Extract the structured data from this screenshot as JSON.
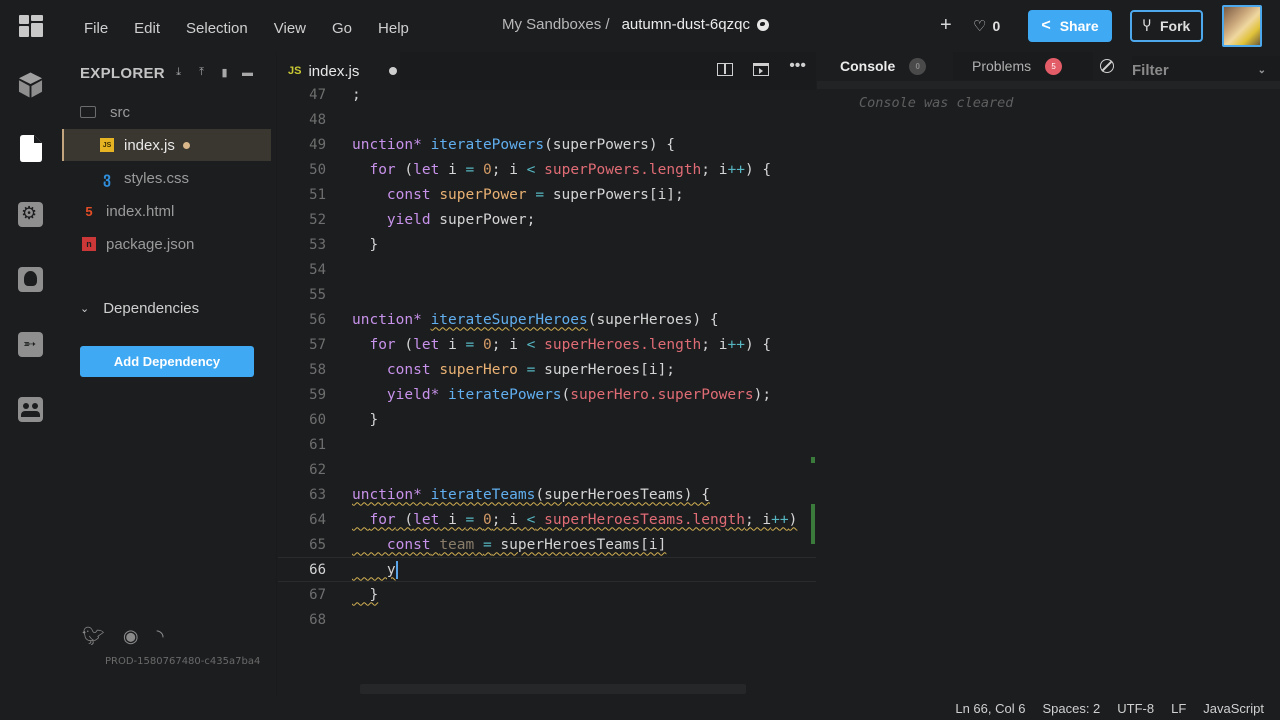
{
  "topbar": {
    "menu": [
      "File",
      "Edit",
      "Selection",
      "View",
      "Go",
      "Help"
    ],
    "breadcrumb_parent": "My Sandboxes /",
    "sandbox_title": "autumn-dust-6qzqc",
    "likes_count": "0",
    "share_label": "Share",
    "fork_label": "Fork",
    "accent_color": "#40a9f3"
  },
  "activity_bar": {
    "items": [
      "cube-icon",
      "file-icon",
      "gear-icon",
      "github-icon",
      "rocket-icon",
      "users-icon"
    ],
    "active": "file-icon"
  },
  "sidebar": {
    "header": "EXPLORER",
    "header_actions": [
      "download-icon",
      "upload-icon",
      "new-file-icon",
      "new-folder-icon"
    ],
    "files": [
      {
        "name": "src",
        "type": "folder"
      },
      {
        "name": "index.js",
        "type": "js",
        "active": true,
        "modified": true
      },
      {
        "name": "styles.css",
        "type": "css"
      },
      {
        "name": "index.html",
        "type": "html"
      },
      {
        "name": "package.json",
        "type": "json"
      }
    ],
    "dependencies_label": "Dependencies",
    "add_dependency_label": "Add Dependency",
    "build_id": "PROD-1580767480-c435a7ba4"
  },
  "editor": {
    "tab": {
      "label": "index.js",
      "icon": "JS",
      "modified": true
    },
    "lines": [
      {
        "n": "47",
        "text": ";"
      },
      {
        "n": "48",
        "text": ""
      },
      {
        "n": "49",
        "text": "unction* iteratePowers(superPowers) {"
      },
      {
        "n": "50",
        "text": "  for (let i = 0; i < superPowers.length; i++) {"
      },
      {
        "n": "51",
        "text": "    const superPower = superPowers[i];"
      },
      {
        "n": "52",
        "text": "    yield superPower;"
      },
      {
        "n": "53",
        "text": "  }"
      },
      {
        "n": "54",
        "text": ""
      },
      {
        "n": "55",
        "text": ""
      },
      {
        "n": "56",
        "text": "unction* iterateSuperHeroes(superHeroes) {"
      },
      {
        "n": "57",
        "text": "  for (let i = 0; i < superHeroes.length; i++) {"
      },
      {
        "n": "58",
        "text": "    const superHero = superHeroes[i];"
      },
      {
        "n": "59",
        "text": "    yield* iteratePowers(superHero.superPowers);"
      },
      {
        "n": "60",
        "text": "  }"
      },
      {
        "n": "61",
        "text": ""
      },
      {
        "n": "62",
        "text": ""
      },
      {
        "n": "63",
        "text": "unction* iterateTeams(superHeroesTeams) {"
      },
      {
        "n": "64",
        "text": "  for (let i = 0; i < superHeroesTeams.length; i++)"
      },
      {
        "n": "65",
        "text": "    const team = superHeroesTeams[i]"
      },
      {
        "n": "66",
        "text": "    y"
      },
      {
        "n": "67",
        "text": "  }"
      },
      {
        "n": "68",
        "text": ""
      }
    ],
    "current_line": "66"
  },
  "console": {
    "tab_console": "Console",
    "console_count": "0",
    "tab_problems": "Problems",
    "problems_count": "5",
    "filter_placeholder": "Filter",
    "message": "Console was cleared"
  },
  "statusbar": {
    "position": "Ln 66, Col 6",
    "spaces": "Spaces: 2",
    "encoding": "UTF-8",
    "eol": "LF",
    "language": "JavaScript"
  }
}
